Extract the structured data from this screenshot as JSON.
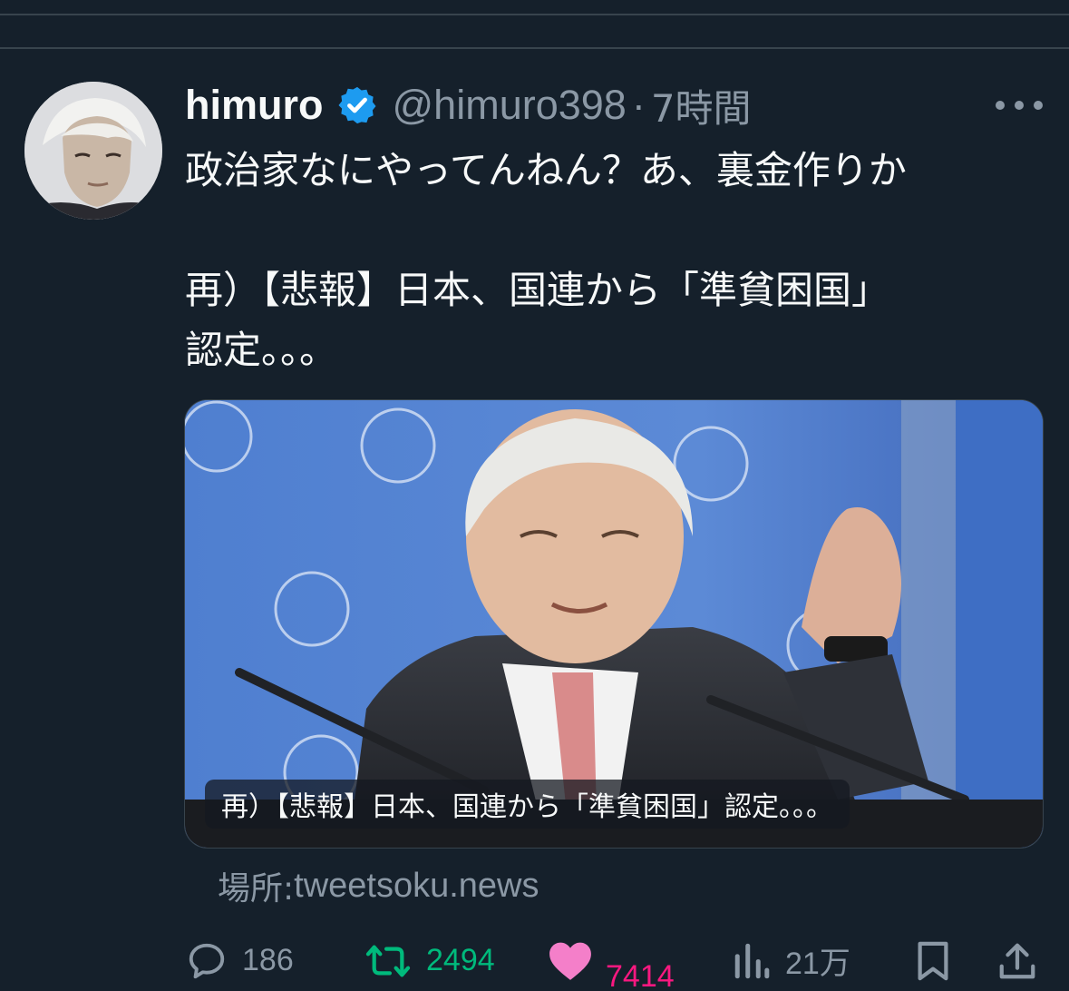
{
  "tweet": {
    "display_name": "himuro",
    "handle": "@himuro398",
    "separator": "·",
    "time": "7時間",
    "text_lines": [
      "政治家なにやってんねん？あ、裏金作りか",
      "",
      "再）【悲報】日本、国連から「準貧困国」",
      "認定。。。"
    ],
    "media_caption": "再）【悲報】日本、国連から「準貧困国」認定。。。",
    "source_prefix": "場所: ",
    "source_domain": "tweetsoku.news"
  },
  "actions": {
    "replies": "186",
    "retweets": "2494",
    "likes": "7414",
    "views": "21万"
  },
  "icons": {
    "verified": "verified-badge-icon",
    "more": "more-dots-icon",
    "reply": "reply-bubble-icon",
    "retweet": "retweet-icon",
    "like": "heart-icon",
    "views": "views-bars-icon",
    "bookmark": "bookmark-icon",
    "share": "share-icon"
  },
  "colors": {
    "background": "#15202b",
    "text": "#f7f9f9",
    "secondary": "#8b98a5",
    "accent_blue": "#1d9bf0",
    "retweet_green": "#00ba7c",
    "like_pink": "#f91880"
  }
}
